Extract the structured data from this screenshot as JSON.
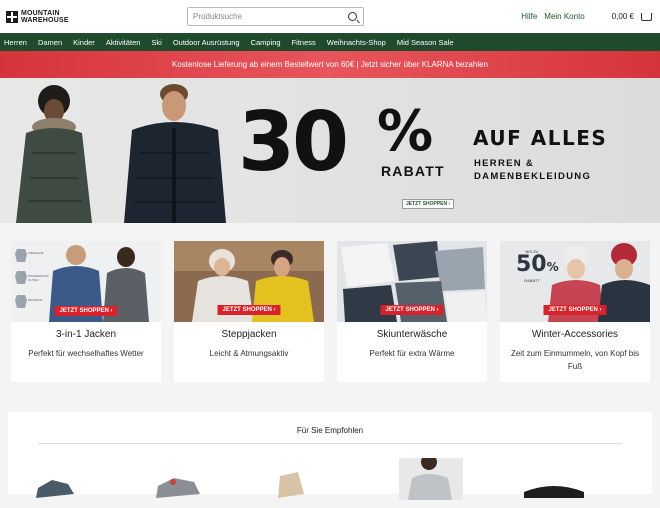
{
  "header": {
    "logo_line1": "MOUNTAIN",
    "logo_line2": "WAREHOUSE",
    "search_placeholder": "Produktsuche",
    "help": "Hilfe",
    "account": "Mein Konto",
    "cart_total": "0,00 €"
  },
  "nav": {
    "items": [
      "Herren",
      "Damen",
      "Kinder",
      "Aktivitäten",
      "Ski",
      "Outdoor Ausrüstung",
      "Camping",
      "Fitness",
      "Weihnachts-Shop",
      "Mid Season Sale"
    ]
  },
  "promo": {
    "text": "Kostenlose Lieferung ab einem Bestellwert von 60€ | Jetzt sicher über KLARNA bezahlen"
  },
  "hero": {
    "percent": "30",
    "percent_sign": "%",
    "rabatt": "RABATT",
    "headline": "AUF ALLES",
    "sub1": "HERREN &",
    "sub2": "DAMENBEKLEIDUNG",
    "button": "JETZT SHOPPEN ›"
  },
  "cards": [
    {
      "title": "3-in-1 Jacken",
      "desc": "Perfekt für wechselhaftes Wetter",
      "button": "JETZT SHOPPEN ›",
      "panel_labels": [
        "FIBRELINE",
        "WATERPROOF OUTER",
        "REVERSE"
      ]
    },
    {
      "title": "Steppjacken",
      "desc": "Leicht & Atmungsaktiv",
      "button": "JETZT SHOPPEN ›"
    },
    {
      "title": "Skiunterwäsche",
      "desc": "Perfekt für extra Wärme",
      "button": "JETZT SHOPPEN ›"
    },
    {
      "title": "Winter-Accessories",
      "desc": "Zeit zum Einmummeln, von Kopf bis Fuß",
      "button": "JETZT SHOPPEN ›",
      "badge_top": "BIS ZU",
      "badge_pct": "50",
      "badge_sign": "%",
      "badge_bottom": "RABATT"
    }
  ],
  "recommended": {
    "title": "Für Sie Empfohlen"
  },
  "colors": {
    "nav_bg": "#1f4a2c",
    "promo_bg": "#d6343b",
    "cta_red": "#d7222b"
  }
}
